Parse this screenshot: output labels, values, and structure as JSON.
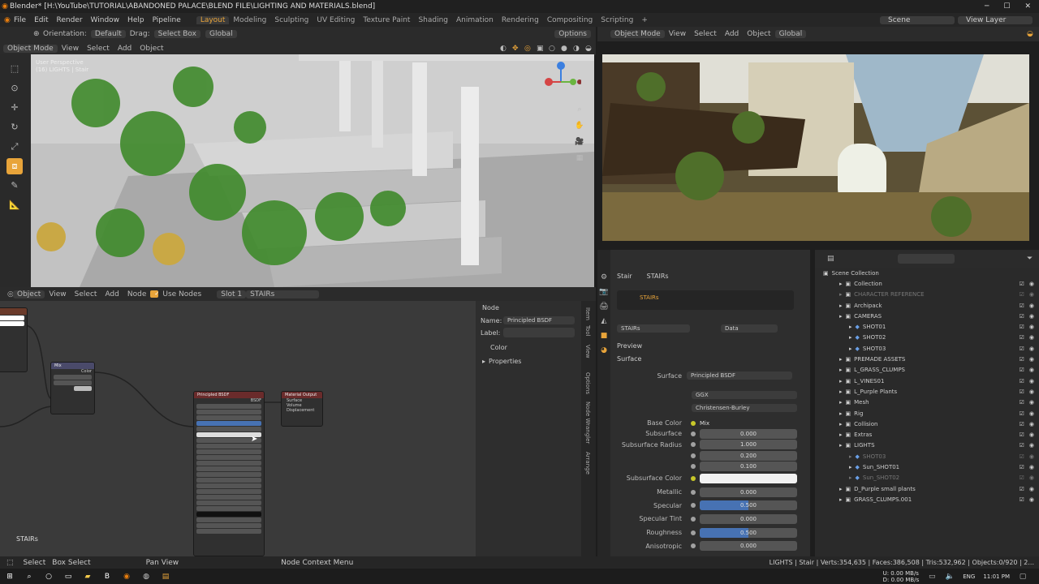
{
  "title": "Blender* [H:\\YouTube\\TUTORIAL\\ABANDONED PALACE\\BLEND FILE\\LIGHTING AND MATERIALS.blend]",
  "menu": [
    "File",
    "Edit",
    "Render",
    "Window",
    "Help",
    "Pipeline"
  ],
  "workspaces": [
    "Layout",
    "Modeling",
    "Sculpting",
    "UV Editing",
    "Texture Paint",
    "Shading",
    "Animation",
    "Rendering",
    "Compositing",
    "Scripting"
  ],
  "scene": "Scene",
  "view_layer": "View Layer",
  "topbar": {
    "orientation_label": "Orientation:",
    "orientation": "Default",
    "drag_label": "Drag:",
    "drag": "Select Box",
    "transform": "Global",
    "options": "Options"
  },
  "vp_header": {
    "mode": "Object Mode",
    "items": [
      "View",
      "Select",
      "Add",
      "Object"
    ]
  },
  "vp_overlay": {
    "line1": "User Perspective",
    "line2": "(16) LIGHTS | Stair"
  },
  "render_header": {
    "mode": "Object Mode",
    "items": [
      "View",
      "Select",
      "Add",
      "Object"
    ],
    "transform": "Global"
  },
  "node_header": {
    "type": "Object",
    "items": [
      "View",
      "Select",
      "Add",
      "Node"
    ],
    "use_nodes": "Use Nodes",
    "slot": "Slot 1",
    "material": "STAIRs"
  },
  "nodes": {
    "principled": "Principled BSDF",
    "output": "Material Output",
    "mix": "Mix",
    "bsdf": "BSDF",
    "color": "Color",
    "surface": "Surface",
    "volume": "Volume",
    "displacement": "Displacement",
    "label_left": "STAIRs"
  },
  "node_panel": {
    "tab": "Node",
    "name_label": "Name:",
    "name": "Principled BSDF",
    "label_label": "Label:",
    "color": "Color",
    "properties": "Properties",
    "side_tabs": [
      "Item",
      "Tool",
      "View",
      "Options",
      "Node Wrangler",
      "Arrange"
    ]
  },
  "props": {
    "breadcrumb": [
      "Stair",
      "STAIRs"
    ],
    "slot": "STAIRs",
    "material": "STAIRs",
    "data": "Data",
    "preview": "Preview",
    "surface_section": "Surface",
    "surface_label": "Surface",
    "surface": "Principled BSDF",
    "distribution": "GGX",
    "sss_method": "Christensen-Burley",
    "fields": [
      {
        "label": "Base Color",
        "value": "Mix",
        "kind": "link"
      },
      {
        "label": "Subsurface",
        "value": "0.000",
        "fill": 0
      },
      {
        "label": "Subsurface Radius",
        "value": "1.000",
        "fill": 0
      },
      {
        "label": "",
        "value": "0.200",
        "fill": 0
      },
      {
        "label": "",
        "value": "0.100",
        "fill": 0
      },
      {
        "label": "Subsurface Color",
        "value": "",
        "kind": "color"
      },
      {
        "label": "Metallic",
        "value": "0.000",
        "fill": 0
      },
      {
        "label": "Specular",
        "value": "0.500",
        "fill": 0.5
      },
      {
        "label": "Specular Tint",
        "value": "0.000",
        "fill": 0
      },
      {
        "label": "Roughness",
        "value": "0.500",
        "fill": 0.5
      },
      {
        "label": "Anisotropic",
        "value": "0.000",
        "fill": 0
      }
    ]
  },
  "outliner": {
    "root": "Scene Collection",
    "items": [
      {
        "name": "Collection",
        "level": 1
      },
      {
        "name": "CHARACTER REFERENCE",
        "level": 1,
        "dim": true
      },
      {
        "name": "Archipack",
        "level": 1
      },
      {
        "name": "CAMERAS",
        "level": 1
      },
      {
        "name": "SHOT01",
        "level": 2
      },
      {
        "name": "SHOT02",
        "level": 2
      },
      {
        "name": "SHOT03",
        "level": 2
      },
      {
        "name": "PREMADE ASSETS",
        "level": 1
      },
      {
        "name": "L_GRASS_CLUMPS",
        "level": 1
      },
      {
        "name": "L_VINES01",
        "level": 1
      },
      {
        "name": "L_Purple Plants",
        "level": 1
      },
      {
        "name": "Mesh",
        "level": 1
      },
      {
        "name": "Rig",
        "level": 1
      },
      {
        "name": "Collision",
        "level": 1
      },
      {
        "name": "Extras",
        "level": 1
      },
      {
        "name": "LIGHTS",
        "level": 1
      },
      {
        "name": "SHOT03",
        "level": 2,
        "dim": true
      },
      {
        "name": "Sun_SHOT01",
        "level": 2
      },
      {
        "name": "Sun_SHOT02",
        "level": 2,
        "dim": true
      },
      {
        "name": "D_Purple small plants",
        "level": 1
      },
      {
        "name": "GRASS_CLUMPS.001",
        "level": 1
      }
    ]
  },
  "status": {
    "select": "Select",
    "box_select": "Box Select",
    "pan_view": "Pan View",
    "context": "Node Context Menu",
    "stats": "LIGHTS | Stair | Verts:354,635 | Faces:386,508 | Tris:532,962 | Objects:0/920 | 2..."
  },
  "taskbar": {
    "net_up": "0.00 MB/s",
    "net_down": "0.00 MB/s",
    "up_label": "U:",
    "down_label": "D:",
    "lang": "ENG",
    "time": "11:01 PM"
  },
  "colors": {
    "accent": "#e8a43a",
    "node_header": "#6a2b2b",
    "field_fill": "#4772b3"
  }
}
